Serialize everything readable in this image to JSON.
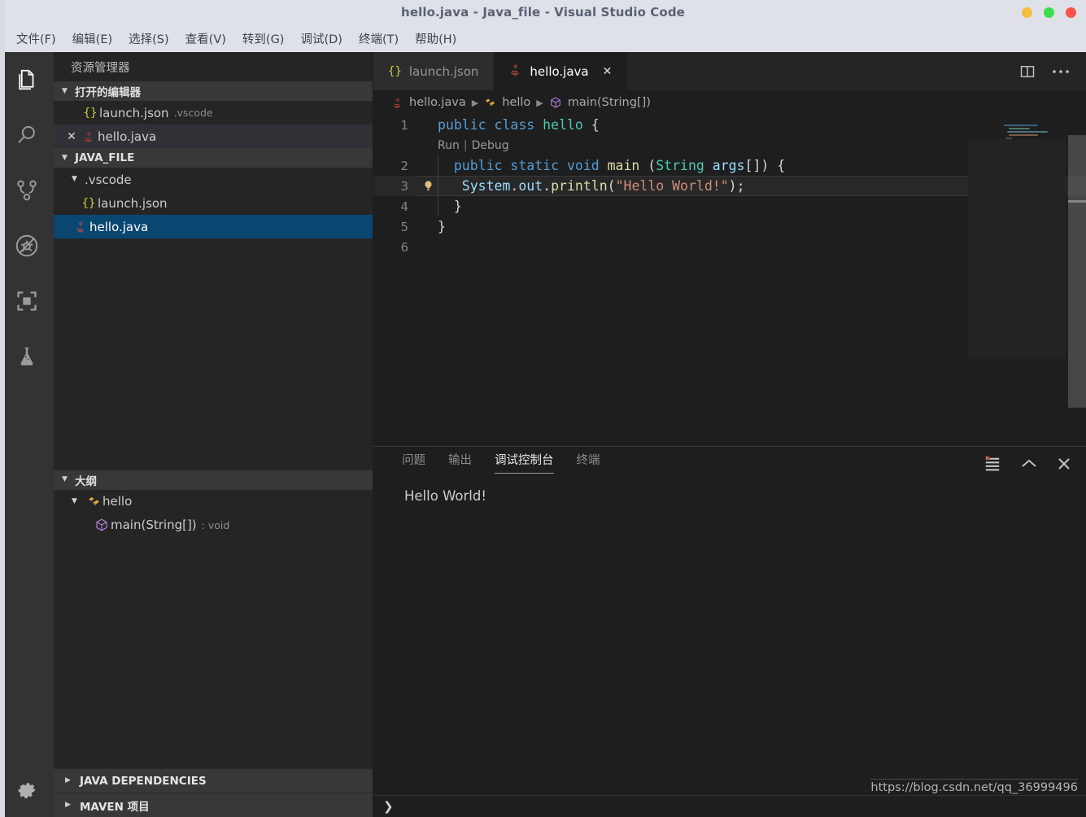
{
  "titlebar": {
    "title": "hello.java - Java_file - Visual Studio Code",
    "window_controls": [
      "minimize",
      "maximize",
      "close"
    ],
    "colors": {
      "minimize": "#f5bd3f",
      "maximize": "#3ddd4c",
      "close": "#f8524b",
      "background": "#dfe1e8"
    }
  },
  "menubar": {
    "items": [
      {
        "label": "文件(F)",
        "name": "menu-file"
      },
      {
        "label": "编辑(E)",
        "name": "menu-edit"
      },
      {
        "label": "选择(S)",
        "name": "menu-selection"
      },
      {
        "label": "查看(V)",
        "name": "menu-view"
      },
      {
        "label": "转到(G)",
        "name": "menu-go"
      },
      {
        "label": "调试(D)",
        "name": "menu-debug"
      },
      {
        "label": "终端(T)",
        "name": "menu-terminal"
      },
      {
        "label": "帮助(H)",
        "name": "menu-help"
      }
    ]
  },
  "activitybar": {
    "items": [
      {
        "icon": "files-explorer-icon",
        "active": true
      },
      {
        "icon": "search-icon",
        "active": false
      },
      {
        "icon": "source-control-icon",
        "active": false
      },
      {
        "icon": "run-and-debug-disabled-icon",
        "active": false
      },
      {
        "icon": "extensions-icon",
        "active": false
      },
      {
        "icon": "testing-beaker-icon",
        "active": false
      }
    ],
    "settings_icon": "gear-icon"
  },
  "sidebar": {
    "title": "资源管理器",
    "open_editors": {
      "header": "打开的编辑器",
      "items": [
        {
          "label": "launch.json",
          "description": ".vscode",
          "icon": "json-icon",
          "selected": false,
          "has_close": false
        },
        {
          "label": "hello.java",
          "description": "",
          "icon": "java-icon",
          "selected": false,
          "has_close": true
        }
      ]
    },
    "folder": {
      "header": "JAVA_FILE",
      "items": [
        {
          "label": ".vscode",
          "icon": "folder-expanded",
          "indent": 1,
          "selected": false
        },
        {
          "label": "launch.json",
          "icon": "json-icon",
          "indent": 2,
          "selected": false
        },
        {
          "label": "hello.java",
          "icon": "java-icon",
          "indent": 1,
          "selected": true
        }
      ]
    },
    "outline": {
      "header": "大纲",
      "items": [
        {
          "label": "hello",
          "icon": "class-icon",
          "detail": "",
          "indent": 1
        },
        {
          "label": "main(String[])",
          "icon": "method-icon",
          "detail": ": void",
          "indent": 2
        }
      ]
    },
    "collapsed_sections": [
      {
        "label": "JAVA DEPENDENCIES",
        "name": "java-dependencies-section"
      },
      {
        "label": "MAVEN 项目",
        "name": "maven-projects-section"
      }
    ]
  },
  "editor": {
    "tabs": [
      {
        "label": "launch.json",
        "icon": "json-icon",
        "active": false,
        "closable": false
      },
      {
        "label": "hello.java",
        "icon": "java-icon",
        "active": true,
        "closable": true
      }
    ],
    "actions": [
      {
        "icon": "split-editor-icon",
        "name": "split-editor-button"
      },
      {
        "icon": "more-actions-icon",
        "name": "more-actions-button"
      }
    ],
    "breadcrumb": [
      {
        "label": "hello.java",
        "icon": "java-icon"
      },
      {
        "label": "hello",
        "icon": "class-icon"
      },
      {
        "label": "main(String[])",
        "icon": "method-icon"
      }
    ],
    "codelens": {
      "run": "Run",
      "separator": "|",
      "debug": "Debug"
    },
    "line_numbers": [
      "1",
      "2",
      "3",
      "4",
      "5",
      "6"
    ],
    "code": {
      "line1": [
        {
          "t": "public class ",
          "c": "kw"
        },
        {
          "t": "hello ",
          "c": "type"
        },
        {
          "t": "{",
          "c": "pl"
        }
      ],
      "line2": [
        {
          "t": "  public static ",
          "c": "kw"
        },
        {
          "t": "void ",
          "c": "kw"
        },
        {
          "t": "main ",
          "c": "fn"
        },
        {
          "t": "(",
          "c": "pl"
        },
        {
          "t": "String ",
          "c": "type"
        },
        {
          "t": "args",
          "c": "var"
        },
        {
          "t": "[]) {",
          "c": "pl"
        }
      ],
      "line3": [
        {
          "t": "   System",
          "c": "var"
        },
        {
          "t": ".",
          "c": "pl"
        },
        {
          "t": "out",
          "c": "var"
        },
        {
          "t": ".",
          "c": "pl"
        },
        {
          "t": "println",
          "c": "fn"
        },
        {
          "t": "(",
          "c": "pl"
        },
        {
          "t": "\"Hello World!\"",
          "c": "str"
        },
        {
          "t": ");",
          "c": "pl"
        }
      ],
      "line4": [
        {
          "t": "  }",
          "c": "pl"
        }
      ],
      "line5": [
        {
          "t": "}",
          "c": "pl"
        }
      ],
      "line6": [
        {
          "t": "",
          "c": "pl"
        }
      ]
    },
    "lightbulb_line": 3,
    "highlighted_line": 3
  },
  "panel": {
    "tabs": [
      {
        "label": "问题",
        "active": false,
        "name": "panel-tab-problems"
      },
      {
        "label": "输出",
        "active": false,
        "name": "panel-tab-output"
      },
      {
        "label": "调试控制台",
        "active": true,
        "name": "panel-tab-debug-console"
      },
      {
        "label": "终端",
        "active": false,
        "name": "panel-tab-terminal"
      }
    ],
    "actions": [
      {
        "icon": "clear-console-icon",
        "name": "clear-console-button"
      },
      {
        "icon": "chevron-up-icon",
        "name": "maximize-panel-button"
      },
      {
        "icon": "close-icon",
        "name": "close-panel-button"
      }
    ],
    "output_lines": [
      "Hello World!"
    ],
    "repl_prompt": "❯"
  },
  "watermark": {
    "text": "https://blog.csdn.net/qq_36999496"
  }
}
